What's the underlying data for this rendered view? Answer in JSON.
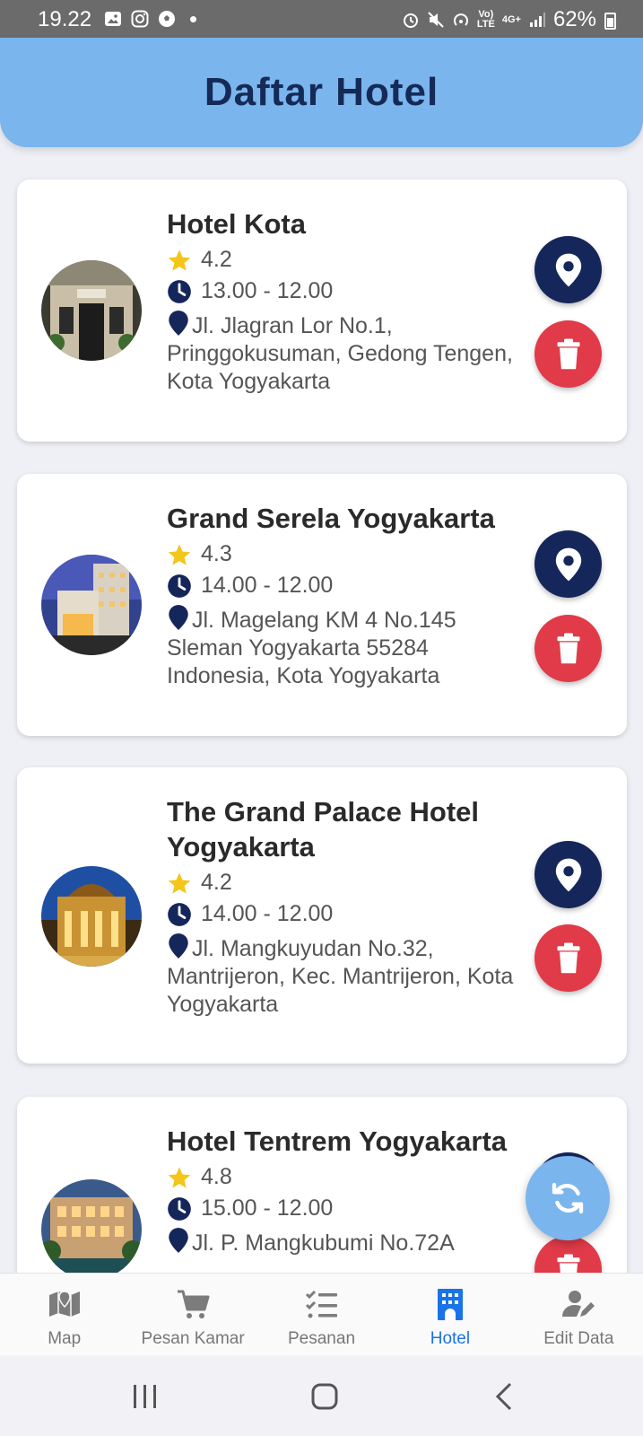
{
  "status_bar": {
    "time": "19.22",
    "network_top": "Vo)",
    "network_bottom": "LTE",
    "signal_label": "4G+",
    "battery": "62%"
  },
  "header": {
    "title": "Daftar Hotel"
  },
  "hotels": [
    {
      "name": "Hotel Kota",
      "rating": "4.2",
      "hours": "13.00 - 12.00",
      "address": "Jl. Jlagran Lor No.1, Pringgokusuman, Gedong Tengen, Kota Yogyakarta"
    },
    {
      "name": "Grand Serela Yogyakarta",
      "rating": "4.3",
      "hours": "14.00 - 12.00",
      "address": "Jl. Magelang KM 4 No.145 Sleman Yogyakarta 55284 Indonesia, Kota Yogyakarta"
    },
    {
      "name": "The Grand Palace Hotel Yogyakarta",
      "rating": "4.2",
      "hours": "14.00 - 12.00",
      "address": "Jl. Mangkuyudan No.32, Mantrijeron, Kec. Mantrijeron, Kota Yogyakarta"
    },
    {
      "name": "Hotel Tentrem Yogyakarta",
      "rating": "4.8",
      "hours": "15.00 - 12.00",
      "address": "Jl. P. Mangkubumi No.72A"
    }
  ],
  "bottom_nav": {
    "items": [
      {
        "label": "Map",
        "icon": "map-icon"
      },
      {
        "label": "Pesan Kamar",
        "icon": "cart-icon"
      },
      {
        "label": "Pesanan",
        "icon": "checklist-icon"
      },
      {
        "label": "Hotel",
        "icon": "hotel-icon"
      },
      {
        "label": "Edit Data",
        "icon": "user-edit-icon"
      }
    ],
    "active": "Hotel"
  },
  "colors": {
    "header_bg": "#7ab5ee",
    "title": "#152a56",
    "location_button": "#15265a",
    "delete_button": "#e13a48",
    "star": "#f5c518",
    "active_nav": "#1a73e8"
  }
}
